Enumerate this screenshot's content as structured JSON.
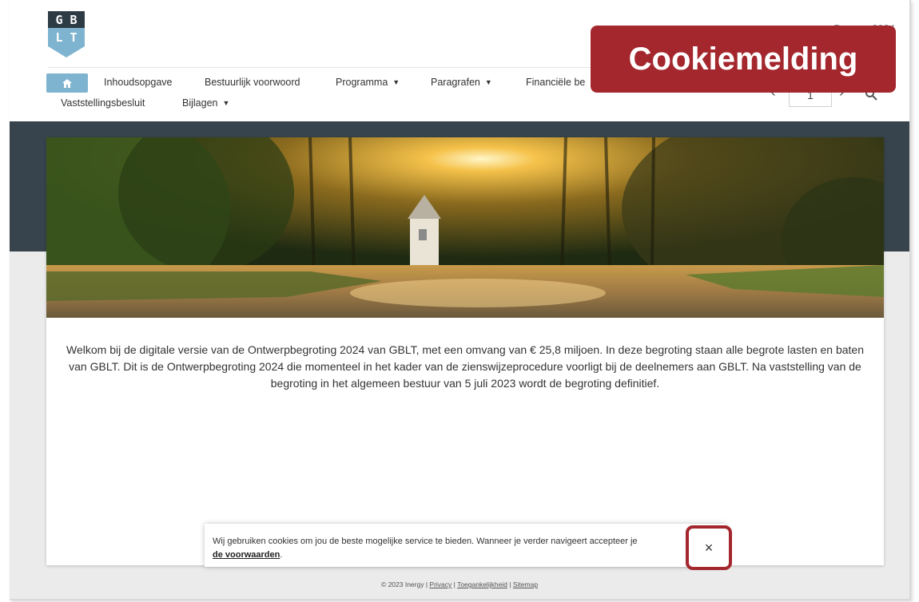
{
  "logo": {
    "line1": "G B",
    "line2": "L T"
  },
  "header": {
    "top_right": "Docs ... 2024"
  },
  "nav": {
    "items": [
      {
        "label": "Inhoudsopgave",
        "has_caret": false
      },
      {
        "label": "Bestuurlijk voorwoord",
        "has_caret": false
      },
      {
        "label": "Programma",
        "has_caret": true
      },
      {
        "label": "Paragrafen",
        "has_caret": true
      },
      {
        "label": "Financiële be",
        "has_caret": false
      },
      {
        "label": "Vaststellingsbesluit",
        "has_caret": false
      },
      {
        "label": "Bijlagen",
        "has_caret": true
      }
    ],
    "pager_value": "1",
    "prev_glyph": "‹",
    "next_glyph": "›"
  },
  "overlay": {
    "cookie_label": "Cookiemelding"
  },
  "intro": {
    "text": "Welkom bij de digitale versie van de Ontwerpbegroting 2024 van GBLT, met een omvang van € 25,8 miljoen. In deze begroting staan alle begrote lasten en baten van GBLT. Dit is de Ontwerpbegroting 2024 die momenteel in het kader van de zienswijzeprocedure voorligt bij de deelnemers aan GBLT. Na vaststelling van de begroting in het algemeen bestuur van 5 juli 2023 wordt de begroting definitief."
  },
  "cookie_bar": {
    "text": "Wij gebruiken cookies om jou de beste mogelijke service te bieden. Wanneer je verder navigeert accepteer je",
    "link": "de voorwaarden",
    "suffix": ".",
    "close_glyph": "×"
  },
  "footer": {
    "copyright": "© 2023 Inergy | ",
    "privacy": "Privacy",
    "sep": " | ",
    "toegankelijkheid": "Toegankelijkheid",
    "sitemap": "Sitemap"
  },
  "colors": {
    "accent": "#a4272e",
    "nav_home": "#7fb4d0",
    "dark_band": "#38444d"
  }
}
